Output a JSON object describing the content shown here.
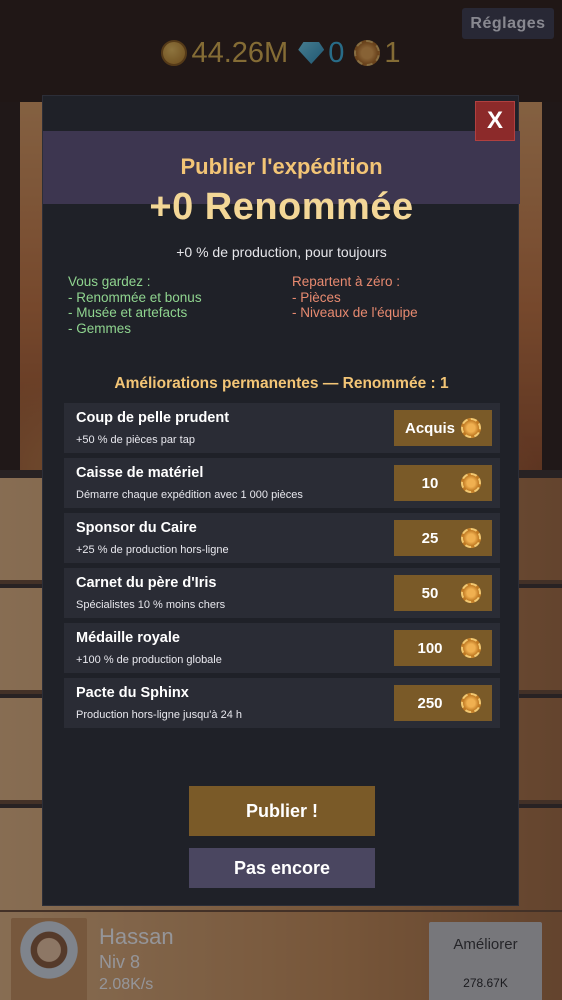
{
  "currency": {
    "coins": "44.26M",
    "gems": "0",
    "renown": "1",
    "coin_icon": "coin-icon",
    "gem_icon": "gem-icon",
    "renown_icon": "renown-medal-icon"
  },
  "header": {
    "settings_label": "Réglages"
  },
  "background_worker": {
    "name": "Hassan",
    "level": "Niv 8",
    "rate": "2.08K/s",
    "upgrade_label": "Améliorer",
    "upgrade_cost": "278.67K"
  },
  "modal": {
    "close_label": "X",
    "title": "Publier l'expédition",
    "renown_gain": "+0 Renommée",
    "subtitle": "+0 % de production, pour toujours",
    "keep": {
      "heading": "Vous gardez :",
      "items": [
        "- Renommée et bonus",
        "- Musée et artefacts",
        "- Gemmes"
      ]
    },
    "reset": {
      "heading": "Repartent à zéro :",
      "items": [
        "- Pièces",
        "- Niveaux de l'équipe"
      ]
    },
    "permanent_title": "Améliorations permanentes — Renommée : 1",
    "upgrades": [
      {
        "name": "Coup de pelle prudent",
        "desc": "+50 % de pièces par tap",
        "cost": "Acquis"
      },
      {
        "name": "Caisse de matériel",
        "desc": "Démarre chaque expédition avec 1 000 pièces",
        "cost": "10"
      },
      {
        "name": "Sponsor du Caire",
        "desc": "+25 % de production hors-ligne",
        "cost": "25"
      },
      {
        "name": "Carnet du père d'Iris",
        "desc": "Spécialistes 10 % moins chers",
        "cost": "50"
      },
      {
        "name": "Médaille royale",
        "desc": "+100 % de production globale",
        "cost": "100"
      },
      {
        "name": "Pacte du Sphinx",
        "desc": "Production hors-ligne jusqu'à 24 h",
        "cost": "250"
      }
    ],
    "publish_label": "Publier !",
    "later_label": "Pas encore"
  },
  "colors": {
    "accent_gold": "#f3c576",
    "button_brown": "#7a5a28",
    "keep_green": "#8fd48f",
    "reset_red": "#e88a70",
    "close_red": "#8c2a2a"
  }
}
